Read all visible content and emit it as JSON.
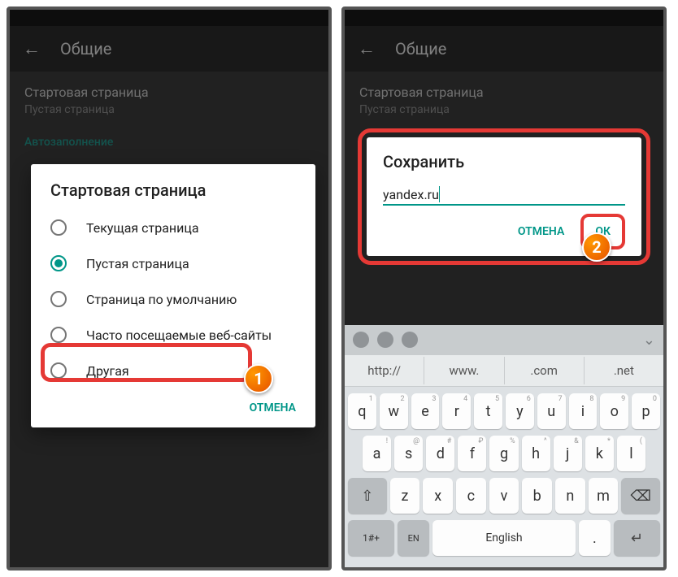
{
  "appbar": {
    "title": "Общие"
  },
  "settings": {
    "startpage_label": "Стартовая страница",
    "startpage_value": "Пустая страница",
    "autofill_header": "Автозаполнение"
  },
  "dialog1": {
    "title": "Стартовая страница",
    "options": [
      "Текущая страница",
      "Пустая страница",
      "Страница по умолчанию",
      "Часто посещаемые веб-сайты",
      "Другая"
    ],
    "selected_index": 1,
    "cancel": "ОТМЕНА"
  },
  "dialog2": {
    "title": "Сохранить",
    "value": "yandex.ru",
    "cancel": "ОТМЕНА",
    "ok": "ОК"
  },
  "badges": {
    "one": "1",
    "two": "2"
  },
  "keyboard": {
    "suggestions": [
      "http://",
      "www.",
      ".com",
      ".net"
    ],
    "row1": [
      "q",
      "w",
      "e",
      "r",
      "t",
      "y",
      "u",
      "i",
      "o",
      "p"
    ],
    "hints1": [
      "1",
      "2",
      "3",
      "4",
      "5",
      "6",
      "7",
      "8",
      "9",
      "0"
    ],
    "row2": [
      "a",
      "s",
      "d",
      "f",
      "g",
      "h",
      "j",
      "k",
      "l"
    ],
    "hints2": [
      "!",
      "@",
      "#",
      "₽",
      "%",
      "^",
      "&",
      "*",
      "(",
      ")"
    ],
    "row3": [
      "z",
      "x",
      "c",
      "v",
      "b",
      "n",
      "m"
    ],
    "shift": "⇧",
    "backspace": "⌫",
    "sym": "1#+",
    "globe": "🌐",
    "lang_short": "EN",
    "space": "English",
    "period": ".",
    "enter": "↵"
  }
}
